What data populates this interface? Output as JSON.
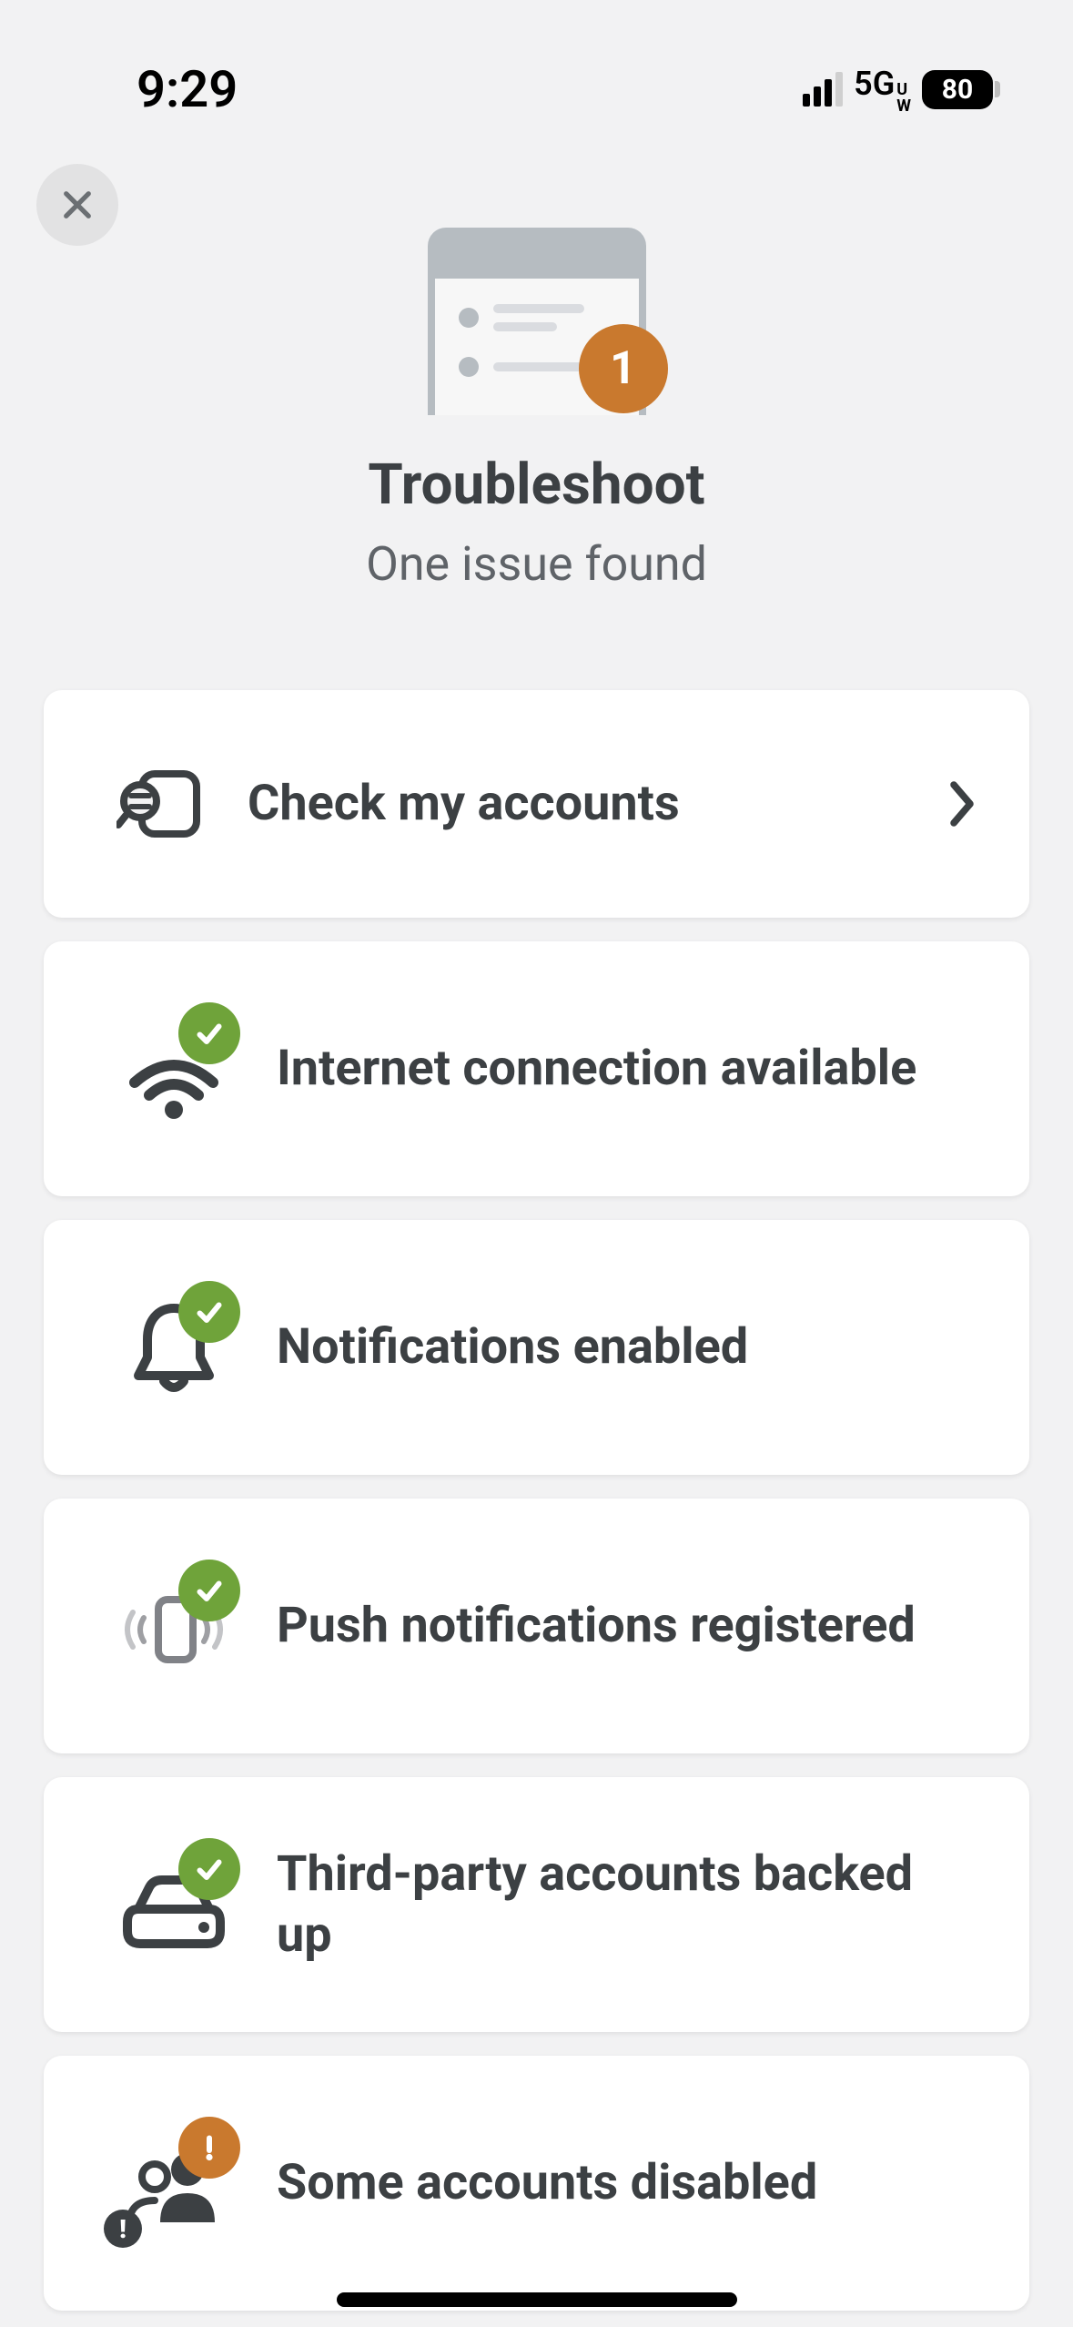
{
  "status_bar": {
    "time": "9:29",
    "network": "5G",
    "network_sub": "UW",
    "battery": "80"
  },
  "hero": {
    "badge_count": "1",
    "title": "Troubleshoot",
    "subtitle": "One issue found"
  },
  "items": [
    {
      "label": "Check my accounts"
    },
    {
      "label": "Internet connection available"
    },
    {
      "label": "Notifications enabled"
    },
    {
      "label": "Push notifications registered"
    },
    {
      "label": "Third-party accounts backed up"
    },
    {
      "label": "Some accounts disabled"
    }
  ]
}
